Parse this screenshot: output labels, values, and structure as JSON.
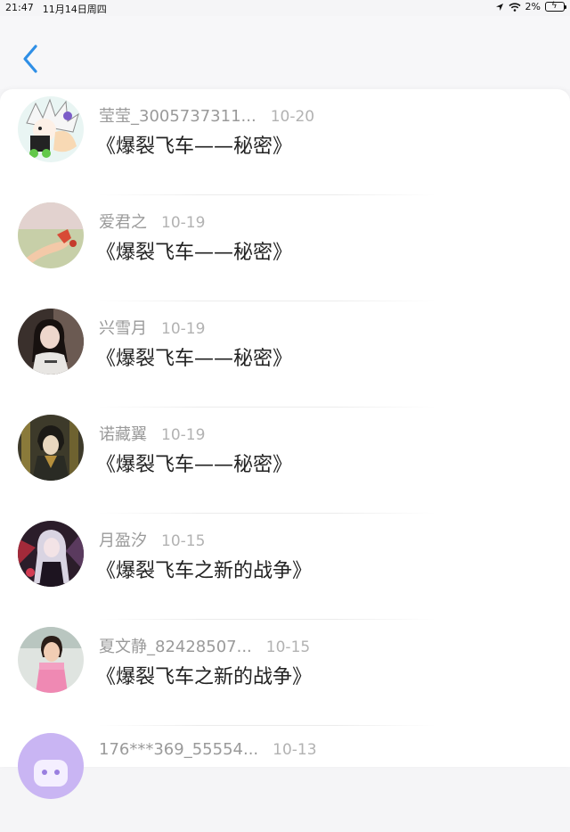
{
  "status_bar": {
    "time": "21:47",
    "date": "11月14日周四",
    "battery": "2%"
  },
  "header": {
    "back_icon": "chevron-left-icon",
    "accent_color": "#2f8fe6"
  },
  "items": [
    {
      "user": "莹莹_3005737311...",
      "date": "10-20",
      "title": "《爆裂飞车——秘密》",
      "avatar_icon": "cartoon-avatar"
    },
    {
      "user": "爱君之",
      "date": "10-19",
      "title": "《爆裂飞车——秘密》",
      "avatar_icon": "hand-flower-avatar"
    },
    {
      "user": "兴雪月",
      "date": "10-19",
      "title": "《爆裂飞车——秘密》",
      "avatar_icon": "girl-photo-avatar"
    },
    {
      "user": "诺藏翼",
      "date": "10-19",
      "title": "《爆裂飞车——秘密》",
      "avatar_icon": "anime-boy-avatar"
    },
    {
      "user": "月盈汐",
      "date": "10-15",
      "title": "《爆裂飞车之新的战争》",
      "avatar_icon": "anime-girl-avatar"
    },
    {
      "user": "夏文静_82428507...",
      "date": "10-15",
      "title": "《爆裂飞车之新的战争》",
      "avatar_icon": "child-photo-avatar"
    },
    {
      "user": "176***369_55554...",
      "date": "10-13",
      "title": "",
      "avatar_icon": "default-purple-avatar"
    }
  ]
}
